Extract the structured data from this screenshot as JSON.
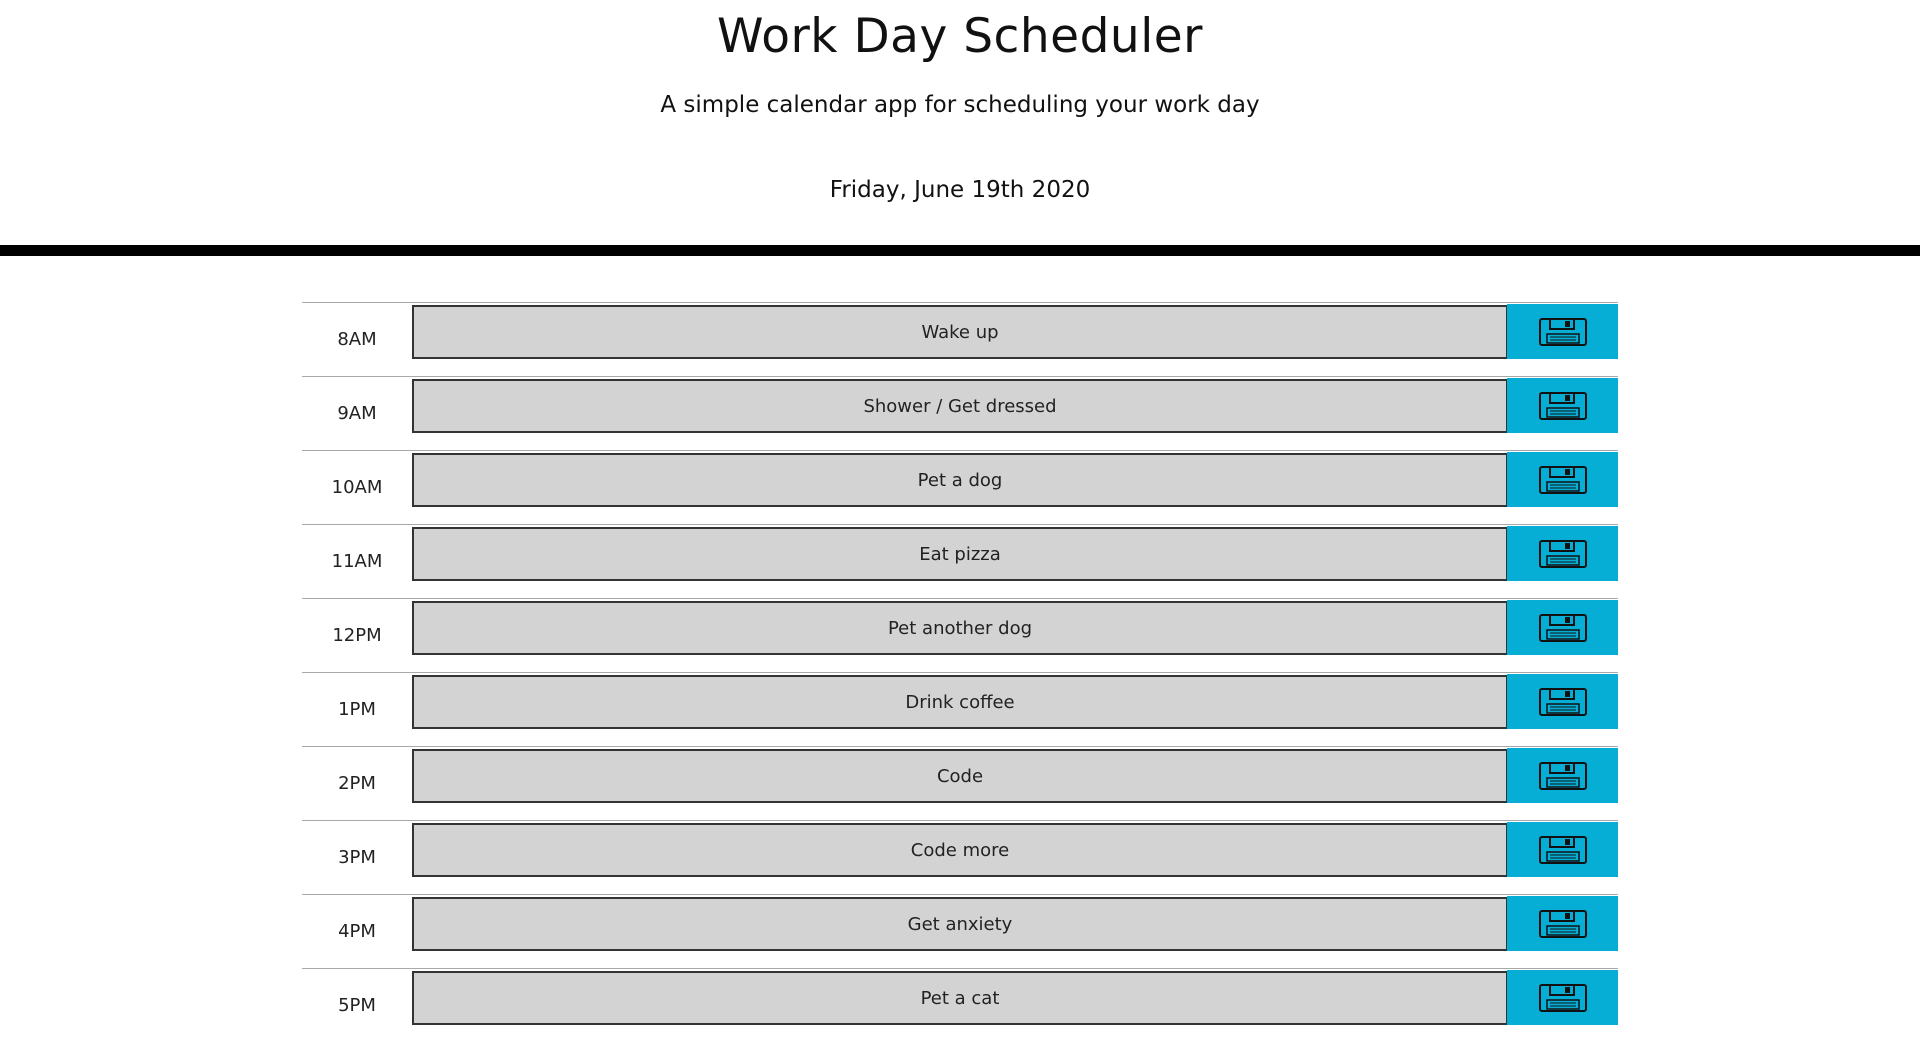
{
  "header": {
    "title": "Work Day Scheduler",
    "subtitle": "A simple calendar app for scheduling your work day",
    "current_day": "Friday, June 19th 2020"
  },
  "colors": {
    "past": "#d3d3d3",
    "save_button": "#06aed5",
    "divider": "#000000"
  },
  "save_icon": "floppy-disk-icon",
  "time_blocks": [
    {
      "hour": "8AM",
      "text": "Wake up"
    },
    {
      "hour": "9AM",
      "text": "Shower / Get dressed"
    },
    {
      "hour": "10AM",
      "text": "Pet a dog"
    },
    {
      "hour": "11AM",
      "text": "Eat pizza"
    },
    {
      "hour": "12PM",
      "text": "Pet another dog"
    },
    {
      "hour": "1PM",
      "text": "Drink coffee"
    },
    {
      "hour": "2PM",
      "text": "Code"
    },
    {
      "hour": "3PM",
      "text": "Code more"
    },
    {
      "hour": "4PM",
      "text": "Get anxiety"
    },
    {
      "hour": "5PM",
      "text": "Pet a cat"
    }
  ]
}
